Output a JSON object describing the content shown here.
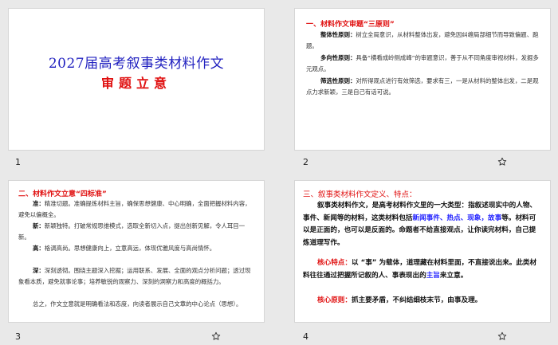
{
  "slides": [
    {
      "number": "1",
      "title": "2027届高考叙事类材料作文",
      "subtitle": "审题立意"
    },
    {
      "number": "2",
      "heading": "一、材料作文审题“三原则”",
      "p1_label": "整体性原则：",
      "p1_text": "树立全局意识，从材料整体出发，避免因纠缠局部细节而导致偏题、跑题。",
      "p2_label": "多向性原则：",
      "p2_text": "具备“横看成岭侧成峰”的审题意识，善于从不同角度审视材料，发掘多元观点。",
      "p3_label": "筛选性原则：",
      "p3_text": "对所得观点进行有效筛选，要求有三，一是从材料的整体出发，二是观点力求新颖，三是自己有话可说。"
    },
    {
      "number": "3",
      "heading": "二、材料作文立意“四标准”",
      "p1_label": "准：",
      "p1_text": "精准切题。准确提炼材料主旨，确保思想健康、中心明确，全面把握材料内容，避免以偏概全。",
      "p2_label": "新：",
      "p2_text": "新颖独特。打破常规思维模式，选取全新切入点，提出创新见解，令人耳目一新。",
      "p3_label": "高：",
      "p3_text": "格调高尚。思想健康向上，立意高远，体现优雅风度与高尚情怀。",
      "p4_label": "深：",
      "p4_text": "深刻透彻。围绕主题深入挖掘；运用联系、发展、全面的观点分析问题；透过现象看本质，避免就事论事；培养敏锐的观察力、深刻的洞察力和高度的概括力。",
      "p5_text": "总之，作文立意就是明确看法和态度，向读者展示自己文章的中心论点（思想）。"
    },
    {
      "number": "4",
      "heading": "三、叙事类材料作文定义、特点：",
      "p1_a": "叙事类材料作文，是高考材料作文里的一大类型：指叙述现实中的人物、事件、新闻等的材料，这类材料包括",
      "p1_b": "新闻事件、热点、现象，故事",
      "p1_c": "等。材料可以是正面的，也可以是反面的。命题者不给直接观点，让你读完材料，自己提炼道理写作。",
      "p2_label": "核心特点：",
      "p2_a": "以 “事” 为载体，道理藏在材料里面，不直接说出来。此类材料往往通过把握所记叙的人、事表现出的",
      "p2_b": "主旨",
      "p2_c": "来立意。",
      "p3_label": "核心原则：",
      "p3_text": "抓主要矛盾，不纠结细枝末节，由事及理。"
    }
  ],
  "icons": {
    "favorite": "star-outline-icon"
  },
  "colors": {
    "title_blue": "#1f1fbf",
    "accent_red": "#e01010",
    "link_blue": "#1f1fff"
  }
}
